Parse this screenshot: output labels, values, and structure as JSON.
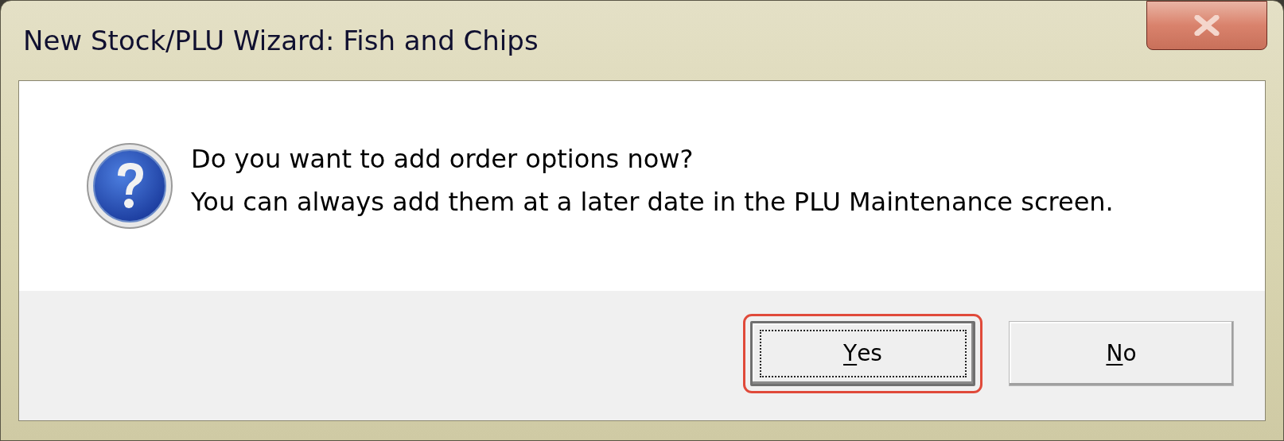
{
  "window": {
    "title": "New Stock/PLU Wizard: Fish and Chips"
  },
  "message": {
    "lines": [
      "Do you want to add order options now?",
      "You can always add them at a later date in the PLU Maintenance screen."
    ]
  },
  "buttons": [
    {
      "label": "Yes",
      "selected": true,
      "highlighted": true,
      "mnemonic_underlined": true
    },
    {
      "label": "No",
      "selected": false,
      "highlighted": false,
      "mnemonic_underlined": true
    }
  ]
}
